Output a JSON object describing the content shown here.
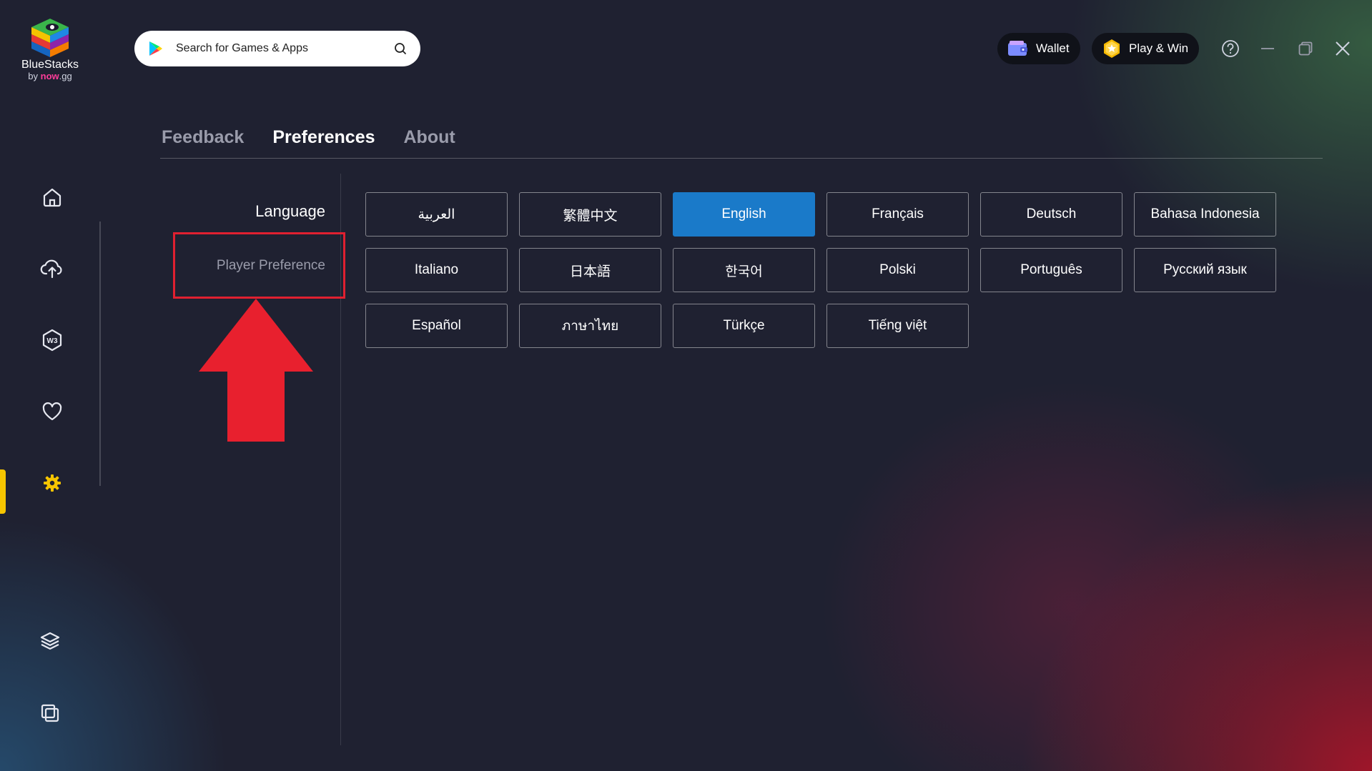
{
  "app": {
    "name": "BlueStacks",
    "by_prefix": "by",
    "by_brand": "now",
    "by_suffix": ".gg"
  },
  "search": {
    "placeholder": "Search for Games & Apps"
  },
  "header": {
    "wallet_label": "Wallet",
    "playwin_label": "Play & Win"
  },
  "sidebar": {
    "items": [
      {
        "name": "home",
        "icon": "home-icon"
      },
      {
        "name": "cloud",
        "icon": "cloud-upload-icon"
      },
      {
        "name": "w3",
        "icon": "w3-icon"
      },
      {
        "name": "favorites",
        "icon": "heart-icon"
      },
      {
        "name": "settings",
        "icon": "gear-icon",
        "active": true
      },
      {
        "name": "layers",
        "icon": "layers-icon"
      },
      {
        "name": "multi-instance",
        "icon": "multi-window-icon"
      }
    ],
    "accent_color": "#f6c500"
  },
  "tabs": [
    {
      "label": "Feedback",
      "active": false
    },
    {
      "label": "Preferences",
      "active": true
    },
    {
      "label": "About",
      "active": false
    }
  ],
  "settings_menu": {
    "language_label": "Language",
    "player_preference_label": "Player Preference"
  },
  "languages": {
    "selected": "English",
    "selected_color": "#1a7ac9",
    "items": [
      "العربية",
      "繁體中文",
      "English",
      "Français",
      "Deutsch",
      "Bahasa Indonesia",
      "Italiano",
      "日本語",
      "한국어",
      "Polski",
      "Português",
      "Русский язык",
      "Español",
      "ภาษาไทย",
      "Türkçe",
      "Tiếng việt"
    ]
  },
  "annotation": {
    "color": "#e02030"
  }
}
